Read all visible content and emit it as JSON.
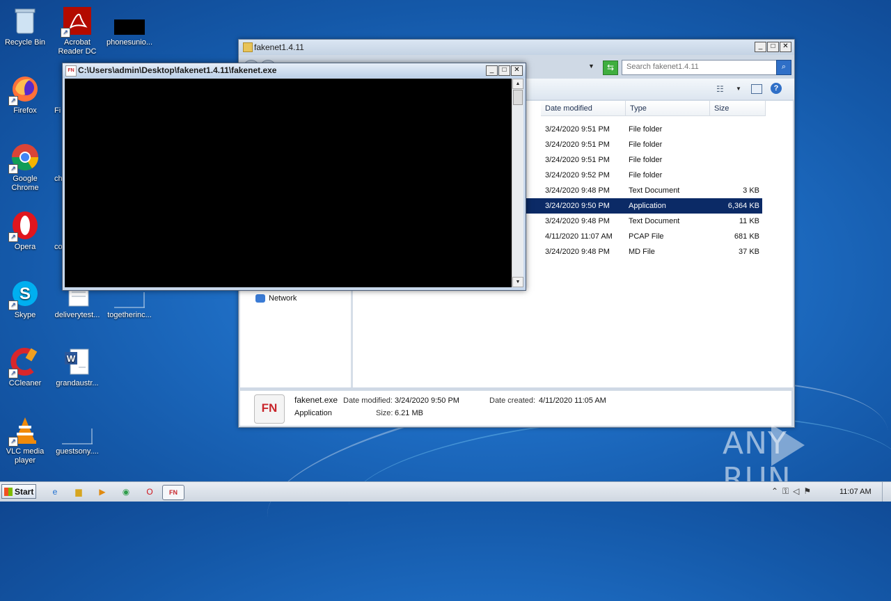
{
  "desktop": {
    "icons_col1": [
      {
        "label": "Recycle Bin",
        "icon": "recycle-bin-icon"
      },
      {
        "label": "Firefox",
        "icon": "firefox-icon"
      },
      {
        "label": "Google Chrome",
        "icon": "chrome-icon"
      },
      {
        "label": "Opera",
        "icon": "opera-icon"
      },
      {
        "label": "Skype",
        "icon": "skype-icon"
      },
      {
        "label": "CCleaner",
        "icon": "ccleaner-icon"
      },
      {
        "label": "VLC media player",
        "icon": "vlc-icon"
      }
    ],
    "icons_col2": [
      {
        "label": "Acrobat Reader DC",
        "icon": "acrobat-icon"
      },
      {
        "label": "phonesunio...",
        "icon": "file-icon"
      },
      {
        "label": "Fi",
        "icon": "file-icon"
      },
      {
        "label": "ch",
        "icon": "file-icon"
      },
      {
        "label": "co",
        "icon": "file-icon"
      },
      {
        "label": "deliverytest...",
        "icon": "word-doc-icon"
      },
      {
        "label": "togetherinc...",
        "icon": "file-icon"
      },
      {
        "label": "grandaustr...",
        "icon": "word-doc-icon"
      },
      {
        "label": "guestsony....",
        "icon": "file-icon"
      }
    ]
  },
  "explorer": {
    "title": "fakenet1.4.11",
    "search_placeholder": "Search fakenet1.4.11",
    "columns": [
      "Date modified",
      "Type",
      "Size"
    ],
    "rows": [
      {
        "date": "3/24/2020 9:51 PM",
        "type": "File folder",
        "size": ""
      },
      {
        "date": "3/24/2020 9:51 PM",
        "type": "File folder",
        "size": ""
      },
      {
        "date": "3/24/2020 9:51 PM",
        "type": "File folder",
        "size": ""
      },
      {
        "date": "3/24/2020 9:52 PM",
        "type": "File folder",
        "size": ""
      },
      {
        "date": "3/24/2020 9:48 PM",
        "type": "Text Document",
        "size": "3 KB"
      },
      {
        "date": "3/24/2020 9:50 PM",
        "type": "Application",
        "size": "6,364 KB"
      },
      {
        "date": "3/24/2020 9:48 PM",
        "type": "Text Document",
        "size": "11 KB"
      },
      {
        "date": "4/11/2020 11:07 AM",
        "type": "PCAP File",
        "size": "681 KB"
      },
      {
        "date": "3/24/2020 9:48 PM",
        "type": "MD File",
        "size": "37 KB"
      }
    ],
    "selected_row": 5,
    "nav_network": "Network",
    "details": {
      "name": "fakenet.exe",
      "type": "Application",
      "modified_label": "Date modified:",
      "modified_value": "3/24/2020 9:50 PM",
      "size_label": "Size:",
      "size_value": "6.21 MB",
      "created_label": "Date created:",
      "created_value": "4/11/2020 11:05 AM",
      "icon_text": "FN"
    }
  },
  "console": {
    "title": "C:\\Users\\admin\\Desktop\\fakenet1.4.11\\fakenet.exe",
    "icon_text": "FN"
  },
  "watermark": {
    "left": "ANY",
    "right": "RUN"
  },
  "taskbar": {
    "start_label": "Start",
    "clock": "11:07 AM",
    "pinned": [
      "ie-icon",
      "explorer-icon",
      "media-player-icon",
      "chrome-icon",
      "opera-icon",
      "fakenet-icon"
    ]
  }
}
